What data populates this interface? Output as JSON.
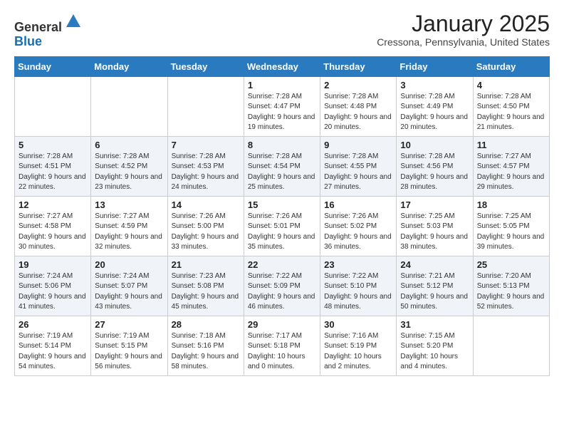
{
  "header": {
    "logo_line1": "General",
    "logo_line2": "Blue",
    "month": "January 2025",
    "location": "Cressona, Pennsylvania, United States"
  },
  "weekdays": [
    "Sunday",
    "Monday",
    "Tuesday",
    "Wednesday",
    "Thursday",
    "Friday",
    "Saturday"
  ],
  "weeks": [
    [
      {
        "day": "",
        "info": ""
      },
      {
        "day": "",
        "info": ""
      },
      {
        "day": "",
        "info": ""
      },
      {
        "day": "1",
        "info": "Sunrise: 7:28 AM\nSunset: 4:47 PM\nDaylight: 9 hours\nand 19 minutes."
      },
      {
        "day": "2",
        "info": "Sunrise: 7:28 AM\nSunset: 4:48 PM\nDaylight: 9 hours\nand 20 minutes."
      },
      {
        "day": "3",
        "info": "Sunrise: 7:28 AM\nSunset: 4:49 PM\nDaylight: 9 hours\nand 20 minutes."
      },
      {
        "day": "4",
        "info": "Sunrise: 7:28 AM\nSunset: 4:50 PM\nDaylight: 9 hours\nand 21 minutes."
      }
    ],
    [
      {
        "day": "5",
        "info": "Sunrise: 7:28 AM\nSunset: 4:51 PM\nDaylight: 9 hours\nand 22 minutes."
      },
      {
        "day": "6",
        "info": "Sunrise: 7:28 AM\nSunset: 4:52 PM\nDaylight: 9 hours\nand 23 minutes."
      },
      {
        "day": "7",
        "info": "Sunrise: 7:28 AM\nSunset: 4:53 PM\nDaylight: 9 hours\nand 24 minutes."
      },
      {
        "day": "8",
        "info": "Sunrise: 7:28 AM\nSunset: 4:54 PM\nDaylight: 9 hours\nand 25 minutes."
      },
      {
        "day": "9",
        "info": "Sunrise: 7:28 AM\nSunset: 4:55 PM\nDaylight: 9 hours\nand 27 minutes."
      },
      {
        "day": "10",
        "info": "Sunrise: 7:28 AM\nSunset: 4:56 PM\nDaylight: 9 hours\nand 28 minutes."
      },
      {
        "day": "11",
        "info": "Sunrise: 7:27 AM\nSunset: 4:57 PM\nDaylight: 9 hours\nand 29 minutes."
      }
    ],
    [
      {
        "day": "12",
        "info": "Sunrise: 7:27 AM\nSunset: 4:58 PM\nDaylight: 9 hours\nand 30 minutes."
      },
      {
        "day": "13",
        "info": "Sunrise: 7:27 AM\nSunset: 4:59 PM\nDaylight: 9 hours\nand 32 minutes."
      },
      {
        "day": "14",
        "info": "Sunrise: 7:26 AM\nSunset: 5:00 PM\nDaylight: 9 hours\nand 33 minutes."
      },
      {
        "day": "15",
        "info": "Sunrise: 7:26 AM\nSunset: 5:01 PM\nDaylight: 9 hours\nand 35 minutes."
      },
      {
        "day": "16",
        "info": "Sunrise: 7:26 AM\nSunset: 5:02 PM\nDaylight: 9 hours\nand 36 minutes."
      },
      {
        "day": "17",
        "info": "Sunrise: 7:25 AM\nSunset: 5:03 PM\nDaylight: 9 hours\nand 38 minutes."
      },
      {
        "day": "18",
        "info": "Sunrise: 7:25 AM\nSunset: 5:05 PM\nDaylight: 9 hours\nand 39 minutes."
      }
    ],
    [
      {
        "day": "19",
        "info": "Sunrise: 7:24 AM\nSunset: 5:06 PM\nDaylight: 9 hours\nand 41 minutes."
      },
      {
        "day": "20",
        "info": "Sunrise: 7:24 AM\nSunset: 5:07 PM\nDaylight: 9 hours\nand 43 minutes."
      },
      {
        "day": "21",
        "info": "Sunrise: 7:23 AM\nSunset: 5:08 PM\nDaylight: 9 hours\nand 45 minutes."
      },
      {
        "day": "22",
        "info": "Sunrise: 7:22 AM\nSunset: 5:09 PM\nDaylight: 9 hours\nand 46 minutes."
      },
      {
        "day": "23",
        "info": "Sunrise: 7:22 AM\nSunset: 5:10 PM\nDaylight: 9 hours\nand 48 minutes."
      },
      {
        "day": "24",
        "info": "Sunrise: 7:21 AM\nSunset: 5:12 PM\nDaylight: 9 hours\nand 50 minutes."
      },
      {
        "day": "25",
        "info": "Sunrise: 7:20 AM\nSunset: 5:13 PM\nDaylight: 9 hours\nand 52 minutes."
      }
    ],
    [
      {
        "day": "26",
        "info": "Sunrise: 7:19 AM\nSunset: 5:14 PM\nDaylight: 9 hours\nand 54 minutes."
      },
      {
        "day": "27",
        "info": "Sunrise: 7:19 AM\nSunset: 5:15 PM\nDaylight: 9 hours\nand 56 minutes."
      },
      {
        "day": "28",
        "info": "Sunrise: 7:18 AM\nSunset: 5:16 PM\nDaylight: 9 hours\nand 58 minutes."
      },
      {
        "day": "29",
        "info": "Sunrise: 7:17 AM\nSunset: 5:18 PM\nDaylight: 10 hours\nand 0 minutes."
      },
      {
        "day": "30",
        "info": "Sunrise: 7:16 AM\nSunset: 5:19 PM\nDaylight: 10 hours\nand 2 minutes."
      },
      {
        "day": "31",
        "info": "Sunrise: 7:15 AM\nSunset: 5:20 PM\nDaylight: 10 hours\nand 4 minutes."
      },
      {
        "day": "",
        "info": ""
      }
    ]
  ]
}
